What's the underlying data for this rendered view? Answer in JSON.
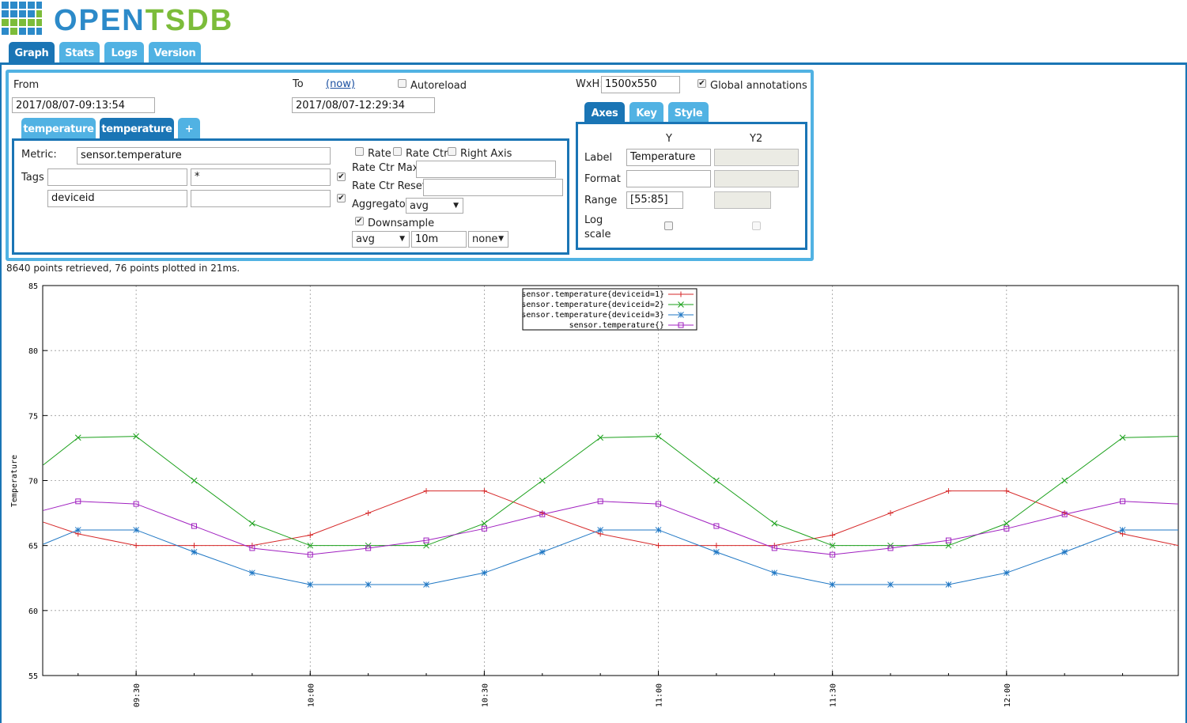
{
  "header": {
    "logo_part1": "OPEN",
    "logo_part2": "TSDB"
  },
  "nav_tabs": [
    {
      "label": "Graph",
      "active": true
    },
    {
      "label": "Stats",
      "active": false
    },
    {
      "label": "Logs",
      "active": false
    },
    {
      "label": "Version",
      "active": false
    }
  ],
  "query": {
    "from_label": "From",
    "from_value": "2017/08/07-09:13:54",
    "to_label": "To",
    "now_link": "(now)",
    "to_value": "2017/08/07-12:29:34",
    "autoreload_label": "Autoreload",
    "autoreload_checked": false,
    "wxh_label": "WxH:",
    "wxh_value": "1500x550",
    "global_annotations_label": "Global annotations",
    "global_annotations_checked": true,
    "metric_tabs": [
      "temperature",
      "temperature",
      "+"
    ],
    "metric_label": "Metric:",
    "metric_value": "sensor.temperature",
    "tags_label": "Tags",
    "tags": [
      {
        "key": "",
        "value": "*",
        "checked": true
      },
      {
        "key": "deviceid",
        "value": "",
        "checked": true
      }
    ],
    "rate_label": "Rate",
    "rate_ctr_label": "Rate Ctr",
    "right_axis_label": "Right Axis",
    "rate_ctr_max_label": "Rate Ctr Max:",
    "rate_ctr_reset_label": "Rate Ctr Reset:",
    "aggregator_label": "Aggregator:",
    "aggregator_value": "avg",
    "downsample_label": "Downsample",
    "downsample_checked": true,
    "downsample_func": "avg",
    "downsample_interval": "10m",
    "downsample_fill": "none"
  },
  "axes_panel": {
    "tabs": [
      "Axes",
      "Key",
      "Style"
    ],
    "col_y": "Y",
    "col_y2": "Y2",
    "label_label": "Label",
    "label_y": "Temperature",
    "format_label": "Format",
    "range_label": "Range",
    "range_y": "[55:85]",
    "log_label": "Log",
    "scale_label": "scale"
  },
  "status_text": "8640 points retrieved, 76 points plotted in 21ms.",
  "colors": {
    "accent": "#1a75b5",
    "tab": "#51b2e3",
    "logo_blue": "#2c8ac9",
    "logo_green": "#7cbc3a"
  },
  "chart_data": {
    "type": "line",
    "ylabel": "Temperature",
    "ylim": [
      55,
      85
    ],
    "y_ticks": [
      55,
      60,
      65,
      70,
      75,
      80,
      85
    ],
    "x_ticks": [
      "09:30",
      "10:00",
      "10:30",
      "11:00",
      "11:30",
      "12:00"
    ],
    "x_tick_minutes": [
      570,
      600,
      630,
      660,
      690,
      720
    ],
    "xlim_minutes": [
      553.9,
      749.6
    ],
    "grid": true,
    "legend_position": "top-center",
    "series": [
      {
        "name": "sensor.temperature{deviceid=1}",
        "color": "#d62728",
        "marker": "plus",
        "x": [
          554,
          560,
          570,
          580,
          590,
          600,
          610,
          620,
          630,
          640,
          650,
          660,
          670,
          680,
          690,
          700,
          710,
          720,
          730,
          740,
          749.6
        ],
        "values": [
          66.8,
          65.9,
          65.0,
          65.0,
          65.0,
          65.8,
          67.5,
          69.2,
          69.2,
          67.5,
          65.9,
          65.0,
          65.0,
          65.0,
          65.8,
          67.5,
          69.2,
          69.2,
          67.5,
          65.9,
          65.0
        ]
      },
      {
        "name": "sensor.temperature{deviceid=2}",
        "color": "#1aa01a",
        "marker": "x",
        "x": [
          554,
          560,
          570,
          580,
          590,
          600,
          610,
          620,
          630,
          640,
          650,
          660,
          670,
          680,
          690,
          700,
          710,
          720,
          730,
          740,
          749.6
        ],
        "values": [
          71.2,
          73.3,
          73.4,
          70.0,
          66.7,
          65.0,
          65.0,
          65.0,
          66.7,
          70.0,
          73.3,
          73.4,
          70.0,
          66.7,
          65.0,
          65.0,
          65.0,
          66.7,
          70.0,
          73.3,
          73.4
        ]
      },
      {
        "name": "sensor.temperature{deviceid=3}",
        "color": "#1f77c4",
        "marker": "star",
        "x": [
          554,
          560,
          570,
          580,
          590,
          600,
          610,
          620,
          630,
          640,
          650,
          660,
          670,
          680,
          690,
          700,
          710,
          720,
          730,
          740,
          749.6
        ],
        "values": [
          65.1,
          66.2,
          66.2,
          64.5,
          62.9,
          62.0,
          62.0,
          62.0,
          62.9,
          64.5,
          66.2,
          66.2,
          64.5,
          62.9,
          62.0,
          62.0,
          62.0,
          62.9,
          64.5,
          66.2,
          66.2
        ]
      },
      {
        "name": "sensor.temperature{}",
        "color": "#a020c0",
        "marker": "square",
        "x": [
          554,
          560,
          570,
          580,
          590,
          600,
          610,
          620,
          630,
          640,
          650,
          660,
          670,
          680,
          690,
          700,
          710,
          720,
          730,
          740,
          749.6
        ],
        "values": [
          67.7,
          68.4,
          68.2,
          66.5,
          64.8,
          64.3,
          64.8,
          65.4,
          66.3,
          67.4,
          68.4,
          68.2,
          66.5,
          64.8,
          64.3,
          64.8,
          65.4,
          66.3,
          67.4,
          68.4,
          68.2
        ]
      }
    ]
  }
}
